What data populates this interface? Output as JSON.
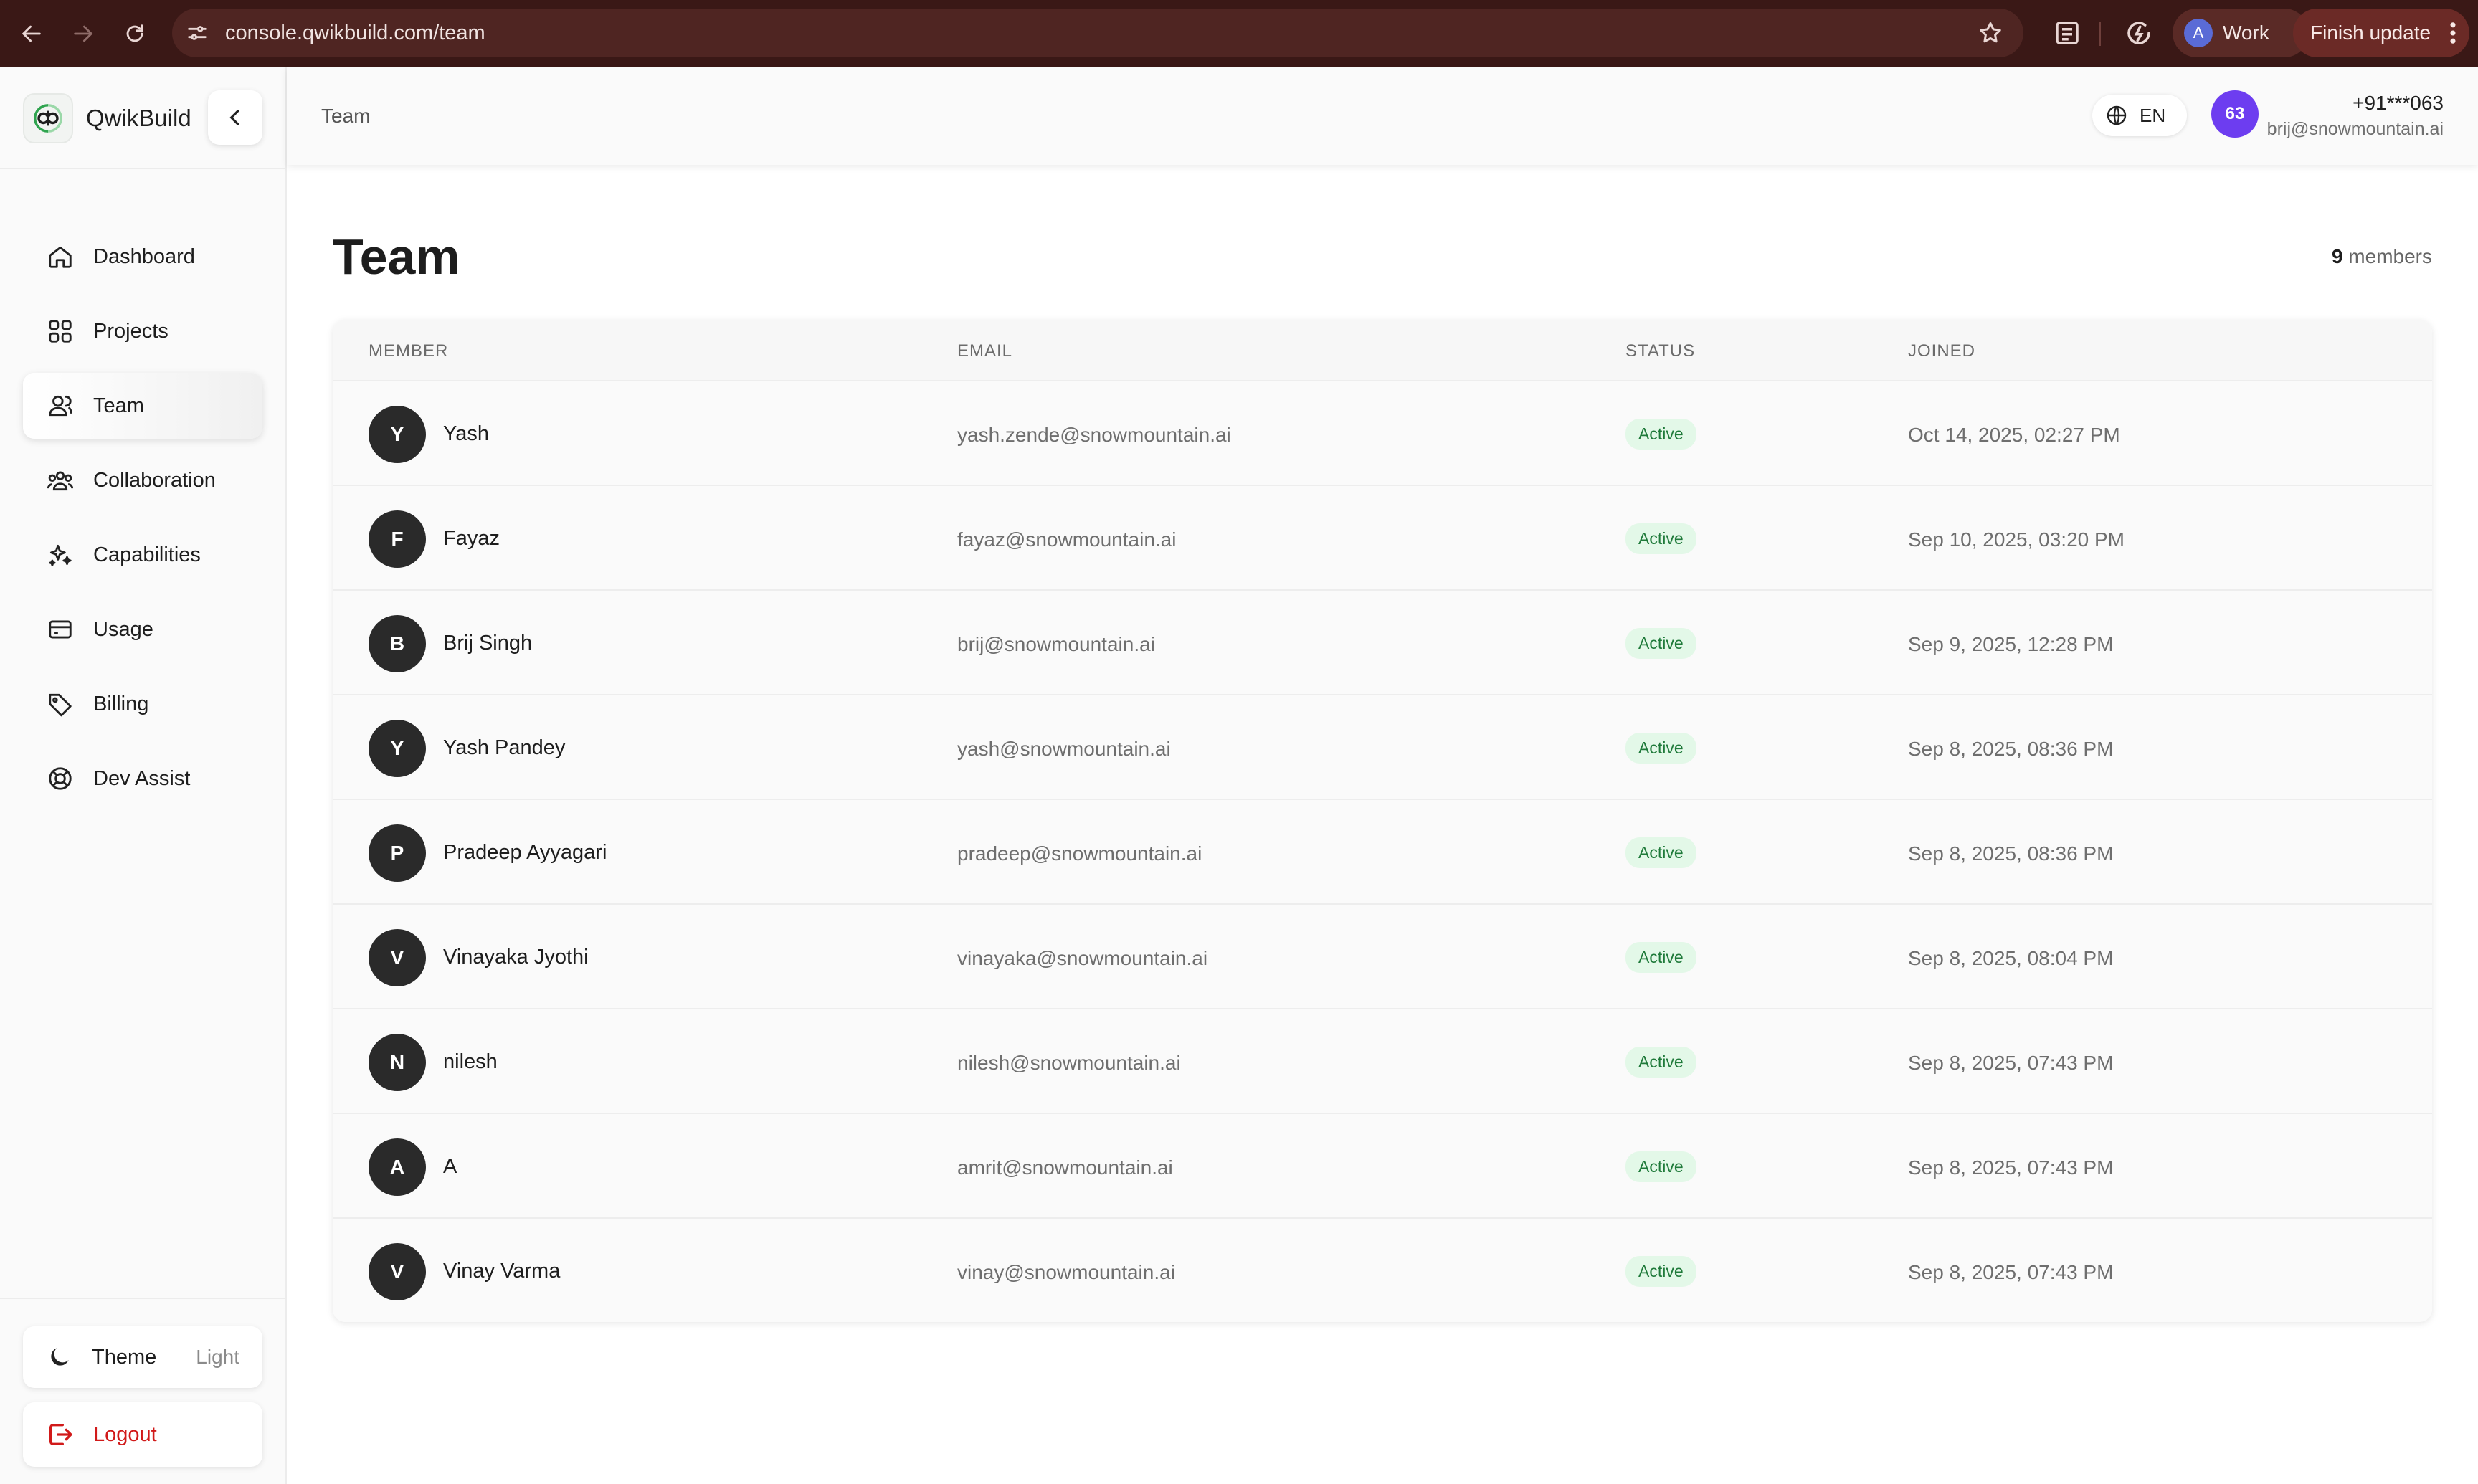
{
  "browser": {
    "url": "console.qwikbuild.com/team",
    "profile_initial": "A",
    "profile_label": "Work",
    "update_label": "Finish update"
  },
  "sidebar": {
    "brand": "QwikBuild",
    "items": [
      {
        "label": "Dashboard",
        "icon": "home-icon",
        "active": false
      },
      {
        "label": "Projects",
        "icon": "grid-icon",
        "active": false
      },
      {
        "label": "Team",
        "icon": "user-icon",
        "active": true
      },
      {
        "label": "Collaboration",
        "icon": "users-icon",
        "active": false
      },
      {
        "label": "Capabilities",
        "icon": "sparkles-icon",
        "active": false
      },
      {
        "label": "Usage",
        "icon": "credit-card-icon",
        "active": false
      },
      {
        "label": "Billing",
        "icon": "tag-icon",
        "active": false
      },
      {
        "label": "Dev Assist",
        "icon": "lifebuoy-icon",
        "active": false
      }
    ],
    "theme_label": "Theme",
    "theme_value": "Light",
    "logout_label": "Logout"
  },
  "header": {
    "breadcrumb": "Team",
    "language": "EN",
    "avatar_text": "63",
    "phone": "+91***063",
    "email": "brij@snowmountain.ai"
  },
  "main": {
    "title": "Team",
    "member_count": "9",
    "member_count_suffix": " members",
    "columns": [
      "MEMBER",
      "EMAIL",
      "STATUS",
      "JOINED"
    ],
    "rows": [
      {
        "initial": "Y",
        "name": "Yash",
        "email": "yash.zende@snowmountain.ai",
        "status": "Active",
        "joined": "Oct 14, 2025, 02:27 PM"
      },
      {
        "initial": "F",
        "name": "Fayaz",
        "email": "fayaz@snowmountain.ai",
        "status": "Active",
        "joined": "Sep 10, 2025, 03:20 PM"
      },
      {
        "initial": "B",
        "name": "Brij Singh",
        "email": "brij@snowmountain.ai",
        "status": "Active",
        "joined": "Sep 9, 2025, 12:28 PM"
      },
      {
        "initial": "Y",
        "name": "Yash Pandey",
        "email": "yash@snowmountain.ai",
        "status": "Active",
        "joined": "Sep 8, 2025, 08:36 PM"
      },
      {
        "initial": "P",
        "name": "Pradeep Ayyagari",
        "email": "pradeep@snowmountain.ai",
        "status": "Active",
        "joined": "Sep 8, 2025, 08:36 PM"
      },
      {
        "initial": "V",
        "name": "Vinayaka Jyothi",
        "email": "vinayaka@snowmountain.ai",
        "status": "Active",
        "joined": "Sep 8, 2025, 08:04 PM"
      },
      {
        "initial": "N",
        "name": "nilesh",
        "email": "nilesh@snowmountain.ai",
        "status": "Active",
        "joined": "Sep 8, 2025, 07:43 PM"
      },
      {
        "initial": "A",
        "name": "A",
        "email": "amrit@snowmountain.ai",
        "status": "Active",
        "joined": "Sep 8, 2025, 07:43 PM"
      },
      {
        "initial": "V",
        "name": "Vinay Varma",
        "email": "vinay@snowmountain.ai",
        "status": "Active",
        "joined": "Sep 8, 2025, 07:43 PM"
      }
    ]
  },
  "colors": {
    "chrome_bg": "#3a1816",
    "accent_avatar": "#6d3df0",
    "status_active_bg": "#e3f8e8",
    "status_active_fg": "#1f7a3a",
    "logout": "#d11a1a"
  }
}
